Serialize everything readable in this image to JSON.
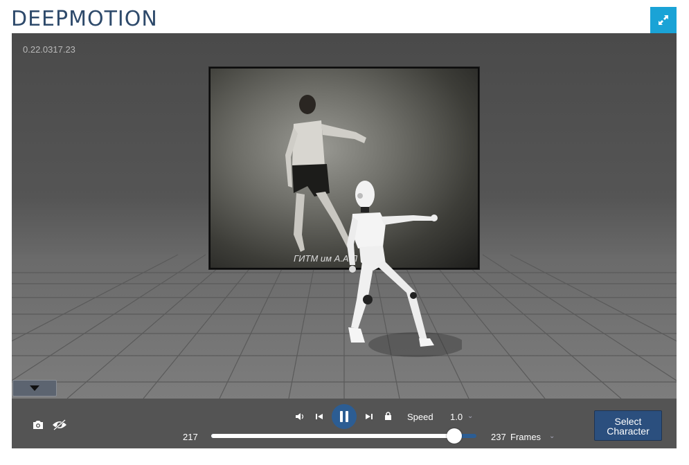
{
  "header": {
    "logo_text": "DEEPMOTION",
    "fullscreen_icon": "expand-icon",
    "accent_color": "#1aa3d6"
  },
  "viewport": {
    "version": "0.22.0317.23",
    "video_caption": "ГИТМ им А.А.Л"
  },
  "controls": {
    "mute_icon": "speaker-icon",
    "prev_icon": "skip-back-icon",
    "play_state_icon": "pause-icon",
    "next_icon": "skip-forward-icon",
    "lock_icon": "lock-icon",
    "speed_label": "Speed",
    "speed_value": "1.0",
    "current_frame": "217",
    "total_frames": "237",
    "frames_label": "Frames",
    "progress_fraction": 0.9156,
    "camera_icon": "camera-icon",
    "visibility_icon": "eye-slash-icon",
    "select_character_line1": "Select",
    "select_character_line2": "Character",
    "button_color": "#2c5d93"
  }
}
